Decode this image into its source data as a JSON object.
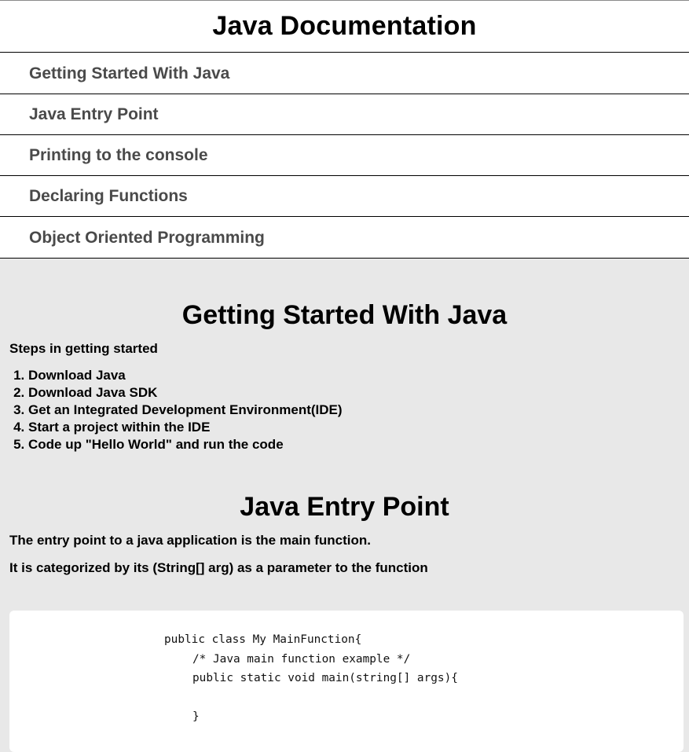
{
  "navbar": {
    "title": "Java Documentation",
    "links": [
      {
        "label": "Getting Started With Java"
      },
      {
        "label": "Java Entry Point"
      },
      {
        "label": "Printing to the console"
      },
      {
        "label": "Declaring Functions"
      },
      {
        "label": "Object Oriented Programming"
      }
    ]
  },
  "sections": {
    "getting_started": {
      "title": "Getting Started With Java",
      "intro": "Steps in getting started",
      "steps": [
        "Download Java",
        "Download Java SDK",
        "Get an Integrated Development Environment(IDE)",
        "Start a project within the IDE",
        "Code up \"Hello World\" and run the code"
      ]
    },
    "entry_point": {
      "title": "Java Entry Point",
      "p1": "The entry point to a java application is the main function.",
      "p2": "It is categorized by its (String[] arg) as a parameter to the function",
      "code": [
        "public class My MainFunction{",
        "/* Java main function example */",
        "public static void main(string[] args){",
        "",
        "}"
      ]
    }
  },
  "colors": {
    "page_bg": "#e8e8e8",
    "nav_bg": "#ffffff",
    "nav_link": "#4a4a4a",
    "code_bg": "#ffffff"
  }
}
